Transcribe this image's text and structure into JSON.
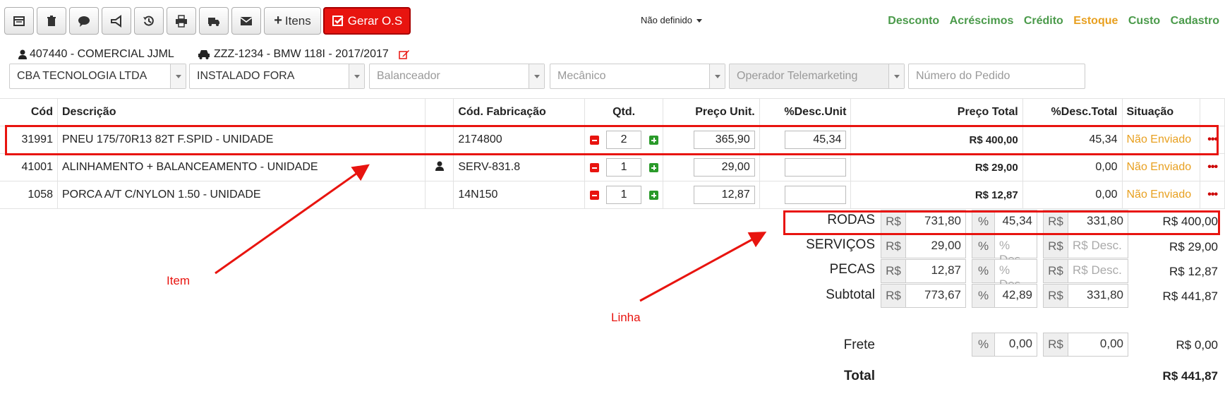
{
  "toolbar": {
    "itens_label": "Itens",
    "gerar_label": "Gerar O.S",
    "status_dropdown": "Não definido"
  },
  "top_links": {
    "desconto": "Desconto",
    "acrescimos": "Acréscimos",
    "credito": "Crédito",
    "estoque": "Estoque",
    "custo": "Custo",
    "cadastro": "Cadastro"
  },
  "header": {
    "client": "407440 - COMERCIAL JJML",
    "vehicle": "ZZZ-1234 - BMW 118I - 2017/2017"
  },
  "filters": {
    "company": "CBA TECNOLOGIA LTDA",
    "install": "INSTALADO FORA",
    "balanceador": "Balanceador",
    "mecanico": "Mecânico",
    "operador": "Operador Telemarketing",
    "pedido_placeholder": "Número do Pedido"
  },
  "table": {
    "headers": {
      "cod": "Cód",
      "descricao": "Descrição",
      "cod_fab": "Cód. Fabricação",
      "qtd": "Qtd.",
      "preco_unit": "Preço Unit.",
      "desc_unit": "%Desc.Unit",
      "preco_total": "Preço Total",
      "desc_total": "%Desc.Total",
      "situacao": "Situação"
    },
    "rows": [
      {
        "cod": "31991",
        "descricao": "PNEU 175/70R13 82T F.SPID - UNIDADE",
        "cod_fab": "2174800",
        "qtd": "2",
        "preco_unit": "365,90",
        "desc_unit": "45,34",
        "preco_total": "R$ 400,00",
        "desc_total": "45,34",
        "situacao": "Não Enviado"
      },
      {
        "cod": "41001",
        "descricao": "ALINHAMENTO + BALANCEAMENTO - UNIDADE",
        "cod_fab": "SERV-831.8",
        "qtd": "1",
        "preco_unit": "29,00",
        "desc_unit": "",
        "preco_total": "R$ 29,00",
        "desc_total": "0,00",
        "situacao": "Não Enviado"
      },
      {
        "cod": "1058",
        "descricao": "PORCA A/T C/NYLON 1.50 - UNIDADE",
        "cod_fab": "14N150",
        "qtd": "1",
        "preco_unit": "12,87",
        "desc_unit": "",
        "preco_total": "R$ 12,87",
        "desc_total": "0,00",
        "situacao": "Não Enviado"
      }
    ]
  },
  "totals": {
    "rs": "R$",
    "pct": "%",
    "desc_pct_placeholder": "% Des",
    "desc_rs_placeholder": "R$ Desc.",
    "rodas": {
      "label": "RODAS",
      "value": "731,80",
      "pct": "45,34",
      "desc": "331,80",
      "total": "R$ 400,00"
    },
    "servicos": {
      "label": "SERVIÇOS",
      "value": "29,00",
      "total": "R$ 29,00"
    },
    "pecas": {
      "label": "PECAS",
      "value": "12,87",
      "total": "R$ 12,87"
    },
    "subtotal": {
      "label": "Subtotal",
      "value": "773,67",
      "pct": "42,89",
      "desc": "331,80",
      "total": "R$ 441,87"
    },
    "frete": {
      "label": "Frete",
      "pct": "0,00",
      "value": "0,00",
      "total": "R$ 0,00"
    },
    "total": {
      "label": "Total",
      "value": "R$ 441,87"
    }
  },
  "annotations": {
    "item": "Item",
    "linha": "Linha"
  }
}
